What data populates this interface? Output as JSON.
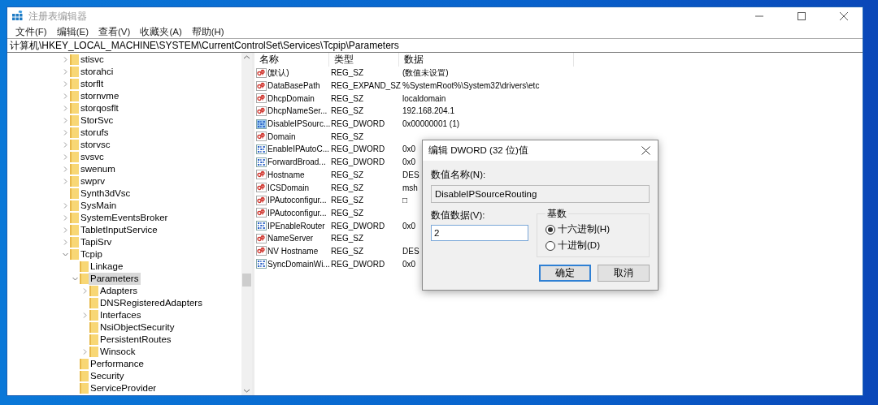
{
  "window": {
    "title": "注册表编辑器"
  },
  "menu": [
    "文件(F)",
    "编辑(E)",
    "查看(V)",
    "收藏夹(A)",
    "帮助(H)"
  ],
  "address": "计算机\\HKEY_LOCAL_MACHINE\\SYSTEM\\CurrentControlSet\\Services\\Tcpip\\Parameters",
  "tree": [
    {
      "label": "stisvc",
      "expandable": true,
      "expanded": false,
      "selected": false
    },
    {
      "label": "storahci",
      "expandable": true,
      "expanded": false,
      "selected": false
    },
    {
      "label": "storflt",
      "expandable": true,
      "expanded": false,
      "selected": false
    },
    {
      "label": "stornvme",
      "expandable": true,
      "expanded": false,
      "selected": false
    },
    {
      "label": "storqosflt",
      "expandable": true,
      "expanded": false,
      "selected": false
    },
    {
      "label": "StorSvc",
      "expandable": true,
      "expanded": false,
      "selected": false
    },
    {
      "label": "storufs",
      "expandable": true,
      "expanded": false,
      "selected": false
    },
    {
      "label": "storvsc",
      "expandable": true,
      "expanded": false,
      "selected": false
    },
    {
      "label": "svsvc",
      "expandable": true,
      "expanded": false,
      "selected": false
    },
    {
      "label": "swenum",
      "expandable": true,
      "expanded": false,
      "selected": false
    },
    {
      "label": "swprv",
      "expandable": true,
      "expanded": false,
      "selected": false
    },
    {
      "label": "Synth3dVsc",
      "expandable": false,
      "expanded": false,
      "selected": false
    },
    {
      "label": "SysMain",
      "expandable": true,
      "expanded": false,
      "selected": false
    },
    {
      "label": "SystemEventsBroker",
      "expandable": true,
      "expanded": false,
      "selected": false
    },
    {
      "label": "TabletInputService",
      "expandable": true,
      "expanded": false,
      "selected": false
    },
    {
      "label": "TapiSrv",
      "expandable": true,
      "expanded": false,
      "selected": false
    },
    {
      "label": "Tcpip",
      "expandable": true,
      "expanded": true,
      "selected": false,
      "children": [
        {
          "label": "Linkage",
          "expandable": false,
          "expanded": false,
          "selected": false
        },
        {
          "label": "Parameters",
          "expandable": true,
          "expanded": true,
          "selected": true,
          "children": [
            {
              "label": "Adapters",
              "expandable": true,
              "expanded": false,
              "selected": false
            },
            {
              "label": "DNSRegisteredAdapters",
              "expandable": false,
              "expanded": false,
              "selected": false
            },
            {
              "label": "Interfaces",
              "expandable": true,
              "expanded": false,
              "selected": false
            },
            {
              "label": "NsiObjectSecurity",
              "expandable": false,
              "expanded": false,
              "selected": false
            },
            {
              "label": "PersistentRoutes",
              "expandable": false,
              "expanded": false,
              "selected": false
            },
            {
              "label": "Winsock",
              "expandable": true,
              "expanded": false,
              "selected": false
            }
          ]
        },
        {
          "label": "Performance",
          "expandable": false,
          "expanded": false,
          "selected": false
        },
        {
          "label": "Security",
          "expandable": false,
          "expanded": false,
          "selected": false
        },
        {
          "label": "ServiceProvider",
          "expandable": false,
          "expanded": false,
          "selected": false
        }
      ]
    }
  ],
  "values": {
    "columns": [
      "名称",
      "类型",
      "数据"
    ],
    "rows": [
      {
        "kind": "string",
        "name": "(默认)",
        "type": "REG_SZ",
        "data": "(数值未设置)",
        "selected": false
      },
      {
        "kind": "string",
        "name": "DataBasePath",
        "type": "REG_EXPAND_SZ",
        "data": "%SystemRoot%\\System32\\drivers\\etc",
        "selected": false
      },
      {
        "kind": "string",
        "name": "DhcpDomain",
        "type": "REG_SZ",
        "data": "localdomain",
        "selected": false
      },
      {
        "kind": "string",
        "name": "DhcpNameSer...",
        "type": "REG_SZ",
        "data": "192.168.204.1",
        "selected": false
      },
      {
        "kind": "dword",
        "name": "DisableIPSourc...",
        "type": "REG_DWORD",
        "data": "0x00000001 (1)",
        "selected": true
      },
      {
        "kind": "string",
        "name": "Domain",
        "type": "REG_SZ",
        "selected": false
      },
      {
        "kind": "dword",
        "name": "EnableIPAutoC...",
        "type": "REG_DWORD",
        "data": "0x0",
        "selected": false
      },
      {
        "kind": "dword",
        "name": "ForwardBroad...",
        "type": "REG_DWORD",
        "data": "0x0",
        "selected": false
      },
      {
        "kind": "string",
        "name": "Hostname",
        "type": "REG_SZ",
        "data": "DES",
        "selected": false
      },
      {
        "kind": "string",
        "name": "ICSDomain",
        "type": "REG_SZ",
        "data": "msh",
        "selected": false
      },
      {
        "kind": "string",
        "name": "IPAutoconfigur...",
        "type": "REG_SZ",
        "data": "□",
        "selected": false
      },
      {
        "kind": "string",
        "name": "IPAutoconfigur...",
        "type": "REG_SZ",
        "selected": false
      },
      {
        "kind": "dword",
        "name": "IPEnableRouter",
        "type": "REG_DWORD",
        "data": "0x0",
        "selected": false
      },
      {
        "kind": "string",
        "name": "NameServer",
        "type": "REG_SZ",
        "selected": false
      },
      {
        "kind": "string",
        "name": "NV Hostname",
        "type": "REG_SZ",
        "data": "DES",
        "selected": false
      },
      {
        "kind": "dword",
        "name": "SyncDomainWi...",
        "type": "REG_DWORD",
        "data": "0x0",
        "selected": false
      }
    ]
  },
  "dialog": {
    "title": "编辑 DWORD (32 位)值",
    "name_label": "数值名称(N):",
    "name_value": "DisableIPSourceRouting",
    "data_label": "数值数据(V):",
    "data_value": "2",
    "base_label": "基数",
    "bases": [
      {
        "label": "十六进制(H)",
        "selected": true
      },
      {
        "label": "十进制(D)",
        "selected": false
      }
    ],
    "buttons": [
      {
        "label": "确定",
        "default": true
      },
      {
        "label": "取消",
        "default": false
      }
    ]
  }
}
